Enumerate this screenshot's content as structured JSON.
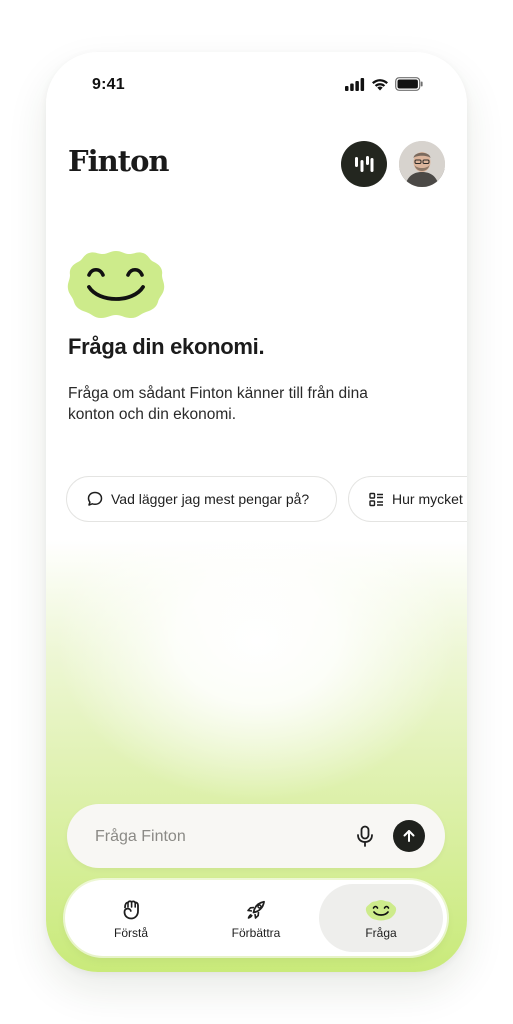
{
  "status_bar": {
    "time": "9:41"
  },
  "header": {
    "logo": "Finton"
  },
  "hero": {
    "title": "Fråga din ekonomi.",
    "description": "Fråga om sådant Finton känner till från dina konton och din ekonomi."
  },
  "suggestions": [
    {
      "label": "Vad lägger jag mest pengar på?",
      "icon": "chat-bubble-icon"
    },
    {
      "label": "Hur mycket",
      "icon": "list-icon"
    }
  ],
  "input": {
    "placeholder": "Fråga Finton"
  },
  "nav": {
    "items": [
      {
        "label": "Förstå",
        "icon": "fist-icon",
        "active": false
      },
      {
        "label": "Förbättra",
        "icon": "rocket-icon",
        "active": false
      },
      {
        "label": "Fråga",
        "icon": "smile-icon",
        "active": true
      }
    ]
  },
  "colors": {
    "accent": "#c9ea7a",
    "dark": "#23261f",
    "mascot": "#cdeb8b"
  }
}
